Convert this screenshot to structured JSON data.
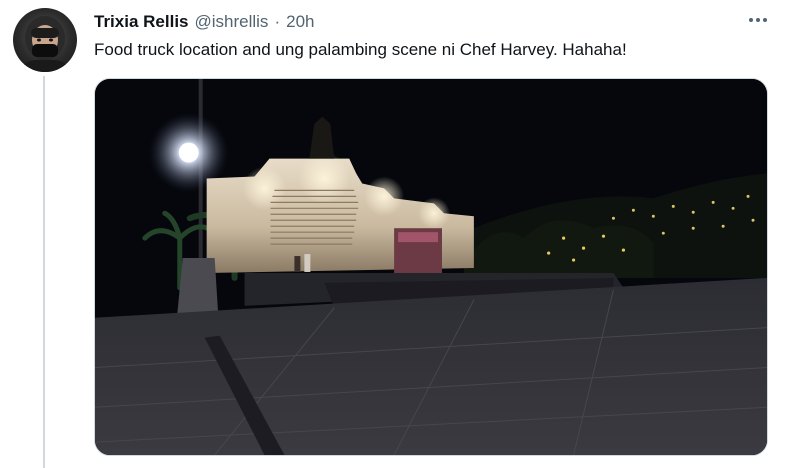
{
  "tweet": {
    "author": {
      "display_name": "Trixia Rellis",
      "handle": "@ishrellis",
      "avatar_icon": "user-avatar"
    },
    "separator": "·",
    "time": "20h",
    "more_icon": "more-horizontal-icon",
    "text": "Food truck location and ung palambing scene ni Chef Harvey. Hahaha!",
    "media": {
      "type": "photo"
    }
  },
  "colors": {
    "text_primary": "#0f1419",
    "text_secondary": "#536471",
    "border": "#cfd9de",
    "background": "#ffffff"
  }
}
